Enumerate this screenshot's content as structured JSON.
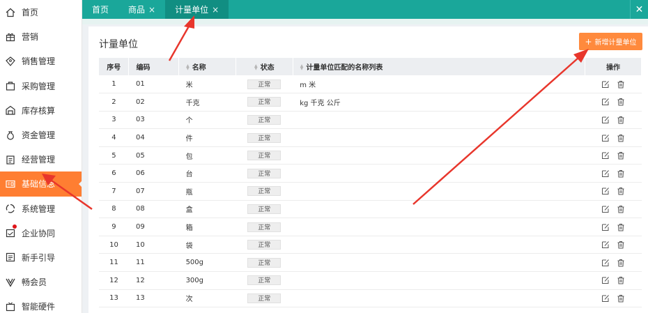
{
  "sidebar": {
    "items": [
      {
        "label": "首页",
        "icon": "home-icon"
      },
      {
        "label": "营销",
        "icon": "gift-icon"
      },
      {
        "label": "销售管理",
        "icon": "tag-icon"
      },
      {
        "label": "采购管理",
        "icon": "bag-icon"
      },
      {
        "label": "库存核算",
        "icon": "warehouse-icon"
      },
      {
        "label": "资金管理",
        "icon": "moneybag-icon"
      },
      {
        "label": "经营管理",
        "icon": "clipboard-icon"
      },
      {
        "label": "基础信息",
        "icon": "idcard-icon"
      },
      {
        "label": "系统管理",
        "icon": "cycle-icon"
      },
      {
        "label": "企业协同",
        "icon": "calendar-icon"
      },
      {
        "label": "新手引导",
        "icon": "guide-icon"
      },
      {
        "label": "畅会员",
        "icon": "v-icon"
      },
      {
        "label": "智能硬件",
        "icon": "tv-icon"
      }
    ],
    "active_index": 7,
    "active_color": "#ff7e32"
  },
  "topbar": {
    "tabs": [
      {
        "label": "首页",
        "closable": false
      },
      {
        "label": "商品",
        "closable": true
      },
      {
        "label": "计量单位",
        "closable": true
      }
    ],
    "close_symbol": "×",
    "window_close_symbol": "✕",
    "color": "#1aa79a"
  },
  "page": {
    "title": "计量单位",
    "add_button": {
      "plus": "+",
      "label": "新增计量单位"
    },
    "accent": "#ff8a3d"
  },
  "table": {
    "headers": [
      "序号",
      "编码",
      "名称",
      "状态",
      "计量单位匹配的名称列表",
      "操作"
    ],
    "rows": [
      {
        "no": "1",
        "code": "01",
        "name": "米",
        "status": "正常",
        "aliases": "m 米"
      },
      {
        "no": "2",
        "code": "02",
        "name": "千克",
        "status": "正常",
        "aliases": "kg 千克 公斤"
      },
      {
        "no": "3",
        "code": "03",
        "name": "个",
        "status": "正常",
        "aliases": ""
      },
      {
        "no": "4",
        "code": "04",
        "name": "件",
        "status": "正常",
        "aliases": ""
      },
      {
        "no": "5",
        "code": "05",
        "name": "包",
        "status": "正常",
        "aliases": ""
      },
      {
        "no": "6",
        "code": "06",
        "name": "台",
        "status": "正常",
        "aliases": ""
      },
      {
        "no": "7",
        "code": "07",
        "name": "瓶",
        "status": "正常",
        "aliases": ""
      },
      {
        "no": "8",
        "code": "08",
        "name": "盒",
        "status": "正常",
        "aliases": ""
      },
      {
        "no": "9",
        "code": "09",
        "name": "箱",
        "status": "正常",
        "aliases": ""
      },
      {
        "no": "10",
        "code": "10",
        "name": "袋",
        "status": "正常",
        "aliases": ""
      },
      {
        "no": "11",
        "code": "11",
        "name": "500g",
        "status": "正常",
        "aliases": ""
      },
      {
        "no": "12",
        "code": "12",
        "name": "300g",
        "status": "正常",
        "aliases": ""
      },
      {
        "no": "13",
        "code": "13",
        "name": "次",
        "status": "正常",
        "aliases": ""
      }
    ]
  },
  "annotation_color": "#e8362c"
}
